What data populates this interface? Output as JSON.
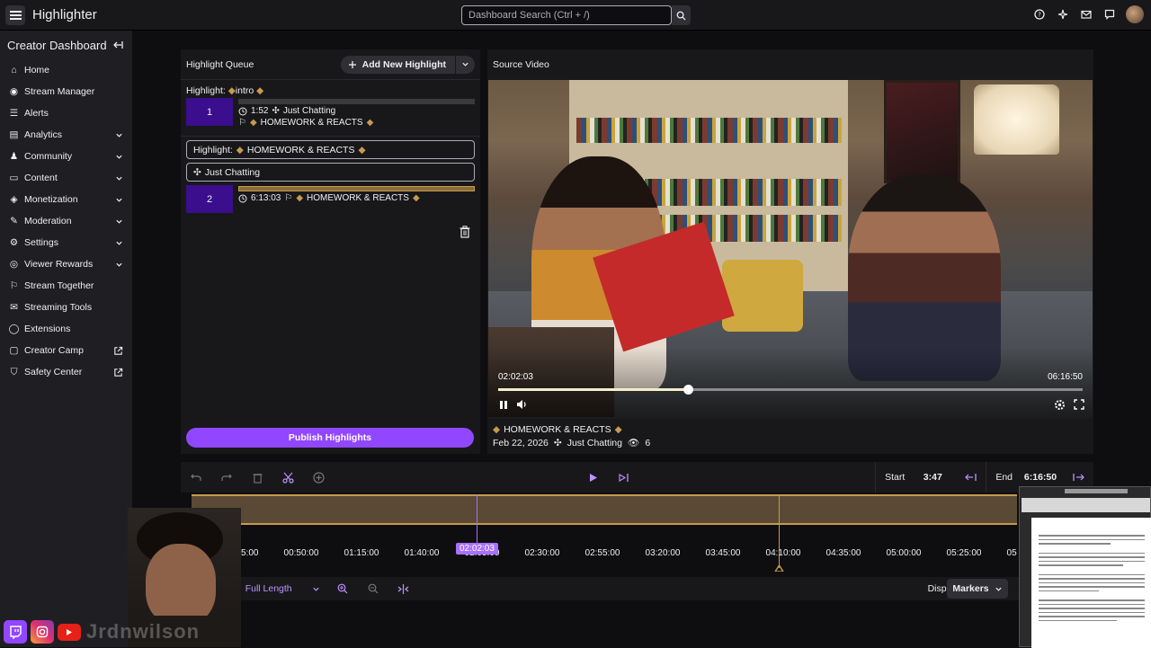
{
  "header": {
    "app_title": "Highlighter",
    "search_placeholder": "Dashboard Search (Ctrl + /)",
    "icons": [
      "menu-icon",
      "search-icon",
      "help-icon",
      "sparkle-icon",
      "inbox-icon",
      "chat-icon",
      "user-avatar"
    ]
  },
  "sidebar": {
    "title": "Creator Dashboard",
    "items": [
      {
        "label": "Home",
        "icon": "home-icon",
        "chevron": false,
        "external": false
      },
      {
        "label": "Stream Manager",
        "icon": "stream-manager-icon",
        "chevron": false,
        "external": false
      },
      {
        "label": "Alerts",
        "icon": "alerts-icon",
        "chevron": false,
        "external": false
      },
      {
        "label": "Analytics",
        "icon": "analytics-icon",
        "chevron": true,
        "external": false
      },
      {
        "label": "Community",
        "icon": "community-icon",
        "chevron": true,
        "external": false
      },
      {
        "label": "Content",
        "icon": "content-icon",
        "chevron": true,
        "external": false
      },
      {
        "label": "Monetization",
        "icon": "monetization-icon",
        "chevron": true,
        "external": false
      },
      {
        "label": "Moderation",
        "icon": "moderation-icon",
        "chevron": true,
        "external": false
      },
      {
        "label": "Settings",
        "icon": "settings-icon",
        "chevron": true,
        "external": false
      },
      {
        "label": "Viewer Rewards",
        "icon": "rewards-icon",
        "chevron": true,
        "external": false
      },
      {
        "label": "Stream Together",
        "icon": "stream-together-icon",
        "chevron": false,
        "external": false
      },
      {
        "label": "Streaming Tools",
        "icon": "streaming-tools-icon",
        "chevron": false,
        "external": false
      },
      {
        "label": "Extensions",
        "icon": "extensions-icon",
        "chevron": false,
        "external": false
      },
      {
        "label": "Creator Camp",
        "icon": "creator-camp-icon",
        "chevron": false,
        "external": true
      },
      {
        "label": "Safety Center",
        "icon": "safety-icon",
        "chevron": false,
        "external": true
      }
    ]
  },
  "queue": {
    "title": "Highlight Queue",
    "add_button": "Add New Highlight",
    "highlight1": {
      "label_prefix": "Highlight:",
      "label_name": "intro",
      "clip_num": "1",
      "duration": "1:52",
      "category": "Just Chatting",
      "title": "HOMEWORK & REACTS"
    },
    "highlight2": {
      "label_prefix": "Highlight:",
      "label_name": "HOMEWORK & REACTS",
      "category": "Just Chatting",
      "clip_num": "2",
      "duration": "6:13:03",
      "title": "HOMEWORK & REACTS"
    },
    "publish_button": "Publish Highlights"
  },
  "source_video": {
    "title": "Source Video",
    "current_time": "02:02:03",
    "end_time": "06:16:50",
    "progress_fraction": 0.325,
    "video_title": "HOMEWORK & REACTS",
    "date": "Feb 22, 2026",
    "category": "Just Chatting",
    "views": "6"
  },
  "toolbar": {
    "start_label": "Start",
    "start_value": "3:47",
    "end_label": "End",
    "end_value": "6:16:50"
  },
  "timeline": {
    "ticks": [
      "00:25:00",
      "00:50:00",
      "01:15:00",
      "01:40:00",
      "02:05:00",
      "02:30:00",
      "02:55:00",
      "03:20:00",
      "03:45:00",
      "04:10:00",
      "04:35:00",
      "05:00:00",
      "05:25:00",
      "05:50:00"
    ],
    "playhead_label": "02:02:03"
  },
  "bottombar": {
    "range_label": "ge",
    "range_value": "Full Length",
    "display_label": "Display",
    "display_value": "Markers"
  },
  "overlay": {
    "streamer_name": "Jrdnwilson"
  },
  "colors": {
    "accent": "#9147ff",
    "clip_block": "#3a0e8c",
    "timeline_gold": "#c79a4e",
    "background": "#0e0e10",
    "panel": "#18181b"
  }
}
